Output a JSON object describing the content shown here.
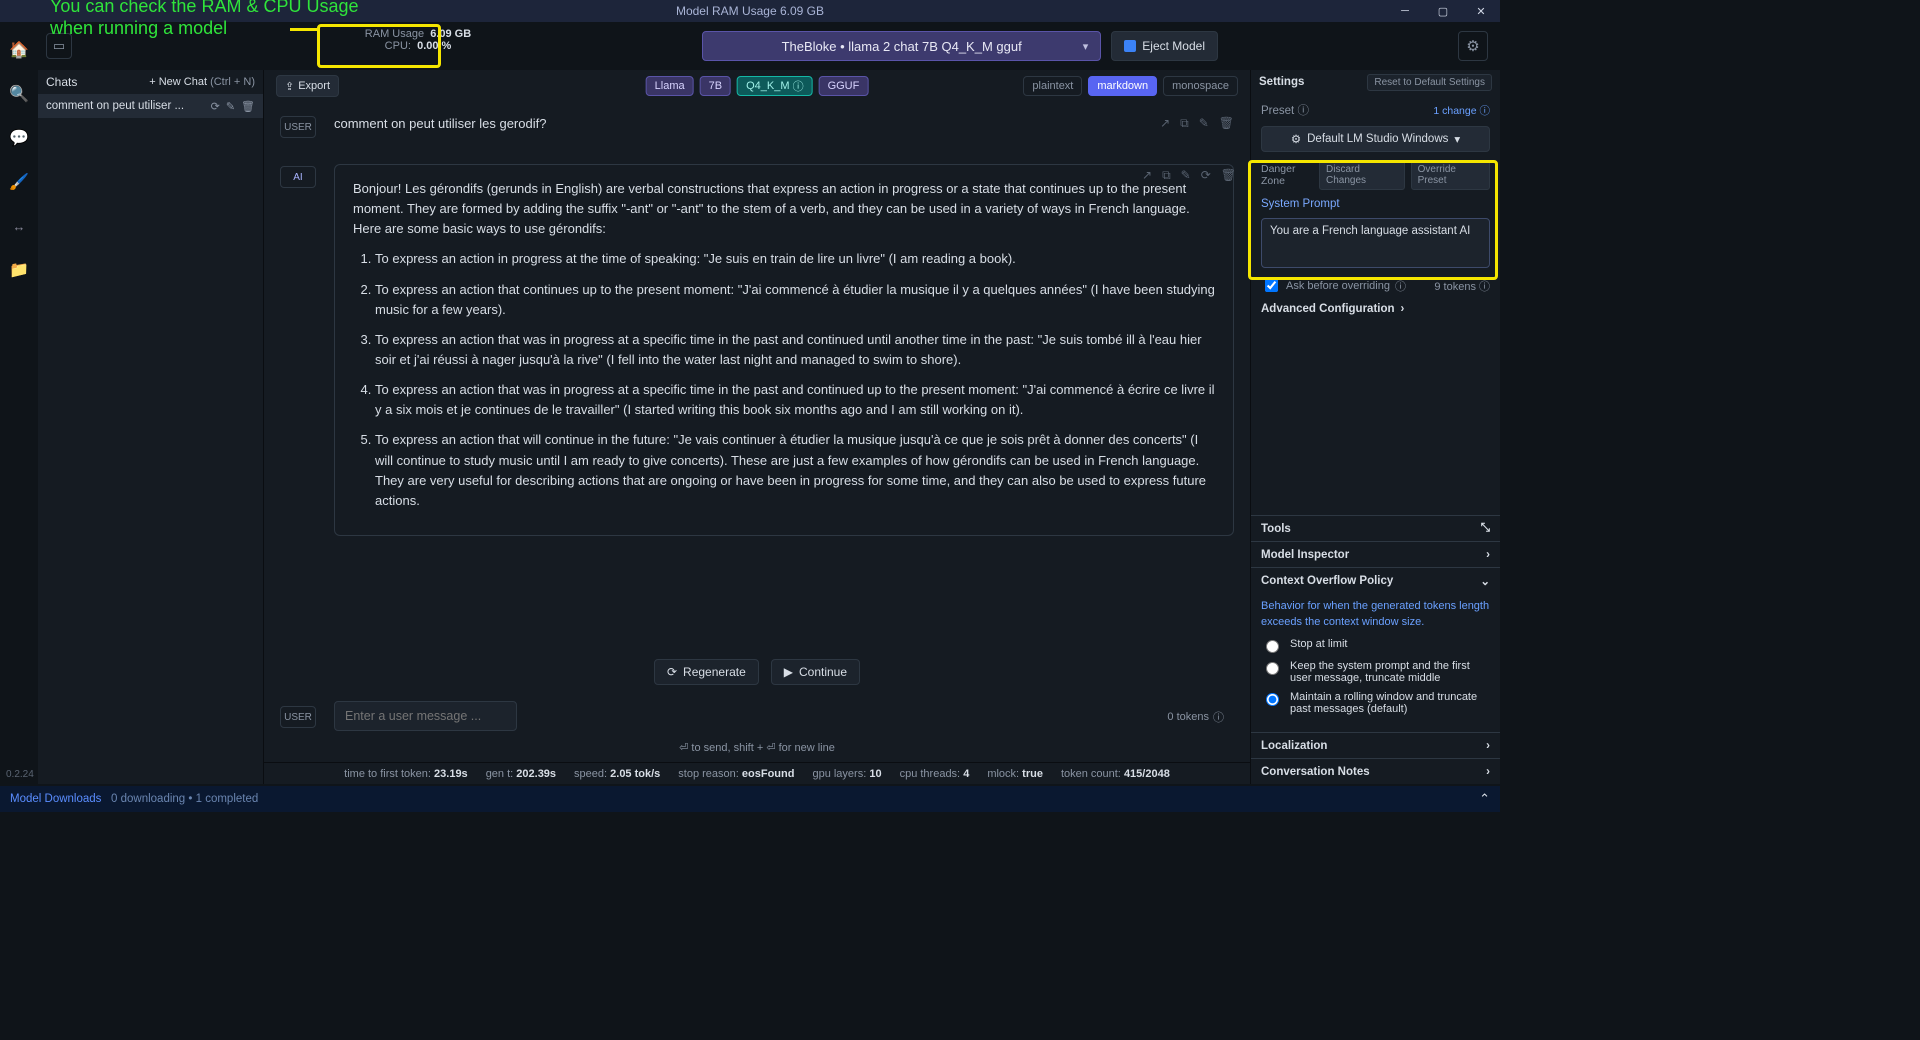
{
  "annotation": {
    "line1": "You can check the RAM & CPU Usage",
    "line2": "when running a model"
  },
  "titlebar": {
    "title": "Model RAM Usage  6.09 GB"
  },
  "rail": {
    "home": "🏠",
    "search": "🔍",
    "chat": "💬",
    "brush": "🖌️",
    "arrows": "↔",
    "folder": "📁"
  },
  "modelbar": {
    "ram_label": "RAM Usage",
    "ram_value": "6.09 GB",
    "cpu_label": "CPU:",
    "cpu_value": "0.00 %",
    "model_name": "TheBloke • llama 2 chat 7B Q4_K_M gguf",
    "eject": "Eject Model"
  },
  "chats": {
    "header": "Chats",
    "new_chat": "+ New Chat",
    "new_chat_hint": "(Ctrl + N)",
    "items": [
      {
        "title": "comment on peut utiliser ..."
      }
    ]
  },
  "tagbar": {
    "export": "Export",
    "tags": [
      "Llama",
      "7B",
      "Q4_K_M",
      "GGUF"
    ],
    "view": [
      "plaintext",
      "markdown",
      "monospace"
    ]
  },
  "conversation": {
    "user_role": "USER",
    "ai_role": "AI",
    "user_msg": "comment on peut utiliser les gerodif?",
    "ai_intro": "Bonjour! Les gérondifs (gerunds in English) are verbal constructions that express an action in progress or a state that continues up to the present moment. They are formed by adding the suffix \"-ant\" or \"-ant\" to the stem of a verb, and they can be used in a variety of ways in French language. Here are some basic ways to use gérondifs:",
    "ai_items": [
      "To express an action in progress at the time of speaking: \"Je suis en train de lire un livre\" (I am reading a book).",
      "To express an action that continues up to the present moment: \"J'ai commencé à étudier la musique il y a quelques années\" (I have been studying music for a few years).",
      "To express an action that was in progress at a specific time in the past and continued until another time in the past: \"Je suis tombé ill à l'eau hier soir et j'ai réussi à nager jusqu'à la rive\" (I fell into the water last night and managed to swim to shore).",
      "To express an action that was in progress at a specific time in the past and continued up to the present moment: \"J'ai commencé à écrire ce livre il y a six mois et je continues de le travailler\" (I started writing this book six months ago and I am still working on it).",
      "To express an action that will continue in the future: \"Je vais continuer à étudier la musique jusqu'à ce que je sois prêt à donner des concerts\" (I will continue to study music until I am ready to give concerts).\nThese are just a few examples of how gérondifs can be used in French language. They are very useful for describing actions that are ongoing or have been in progress for some time, and they can also be used to express future actions."
    ],
    "regenerate": "Regenerate",
    "continue": "Continue",
    "input_placeholder": "Enter a user message ...",
    "token_badge": "0 tokens",
    "hint": "⏎ to send, shift + ⏎ for new line"
  },
  "stats": {
    "ttft_l": "time to first token:",
    "ttft_v": "23.19s",
    "gen_l": "gen t:",
    "gen_v": "202.39s",
    "speed_l": "speed:",
    "speed_v": "2.05 tok/s",
    "stop_l": "stop reason:",
    "stop_v": "eosFound",
    "gpu_l": "gpu layers:",
    "gpu_v": "10",
    "cpu_l": "cpu threads:",
    "cpu_v": "4",
    "mlock_l": "mlock:",
    "mlock_v": "true",
    "tok_l": "token count:",
    "tok_v": "415/2048"
  },
  "settings": {
    "header": "Settings",
    "reset": "Reset to Default Settings",
    "preset_label": "Preset",
    "preset_change": "1 change ⓘ",
    "preset_value": "Default LM Studio Windows",
    "danger_label": "Danger Zone",
    "discard": "Discard Changes",
    "override": "Override Preset",
    "system_prompt_label": "System Prompt",
    "system_prompt_value": "You are a French language assistant AI",
    "ask_label": "Ask before overriding",
    "token_count": "9 tokens ⓘ",
    "adv": "Advanced Configuration",
    "tools": "Tools",
    "inspector": "Model Inspector",
    "overflow_title": "Context Overflow Policy",
    "overflow_desc": "Behavior for when the generated tokens length exceeds the context window size.",
    "overflow_opts": [
      "Stop at limit",
      "Keep the system prompt and the first user message, truncate middle",
      "Maintain a rolling window and truncate past messages (default)"
    ],
    "localization": "Localization",
    "notes": "Conversation Notes"
  },
  "version": "0.2.24",
  "status": {
    "downloads": "Model Downloads",
    "info": "0 downloading • 1 completed"
  }
}
